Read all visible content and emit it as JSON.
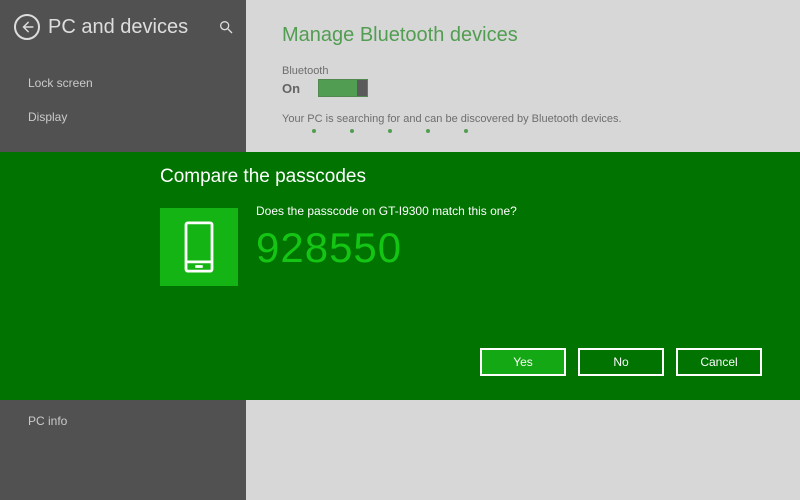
{
  "sidebar": {
    "title": "PC and devices",
    "items": [
      {
        "label": "Lock screen"
      },
      {
        "label": "Display"
      },
      {
        "label": "PC info"
      }
    ]
  },
  "main": {
    "title": "Manage Bluetooth devices",
    "bluetooth_label": "Bluetooth",
    "bluetooth_state": "On",
    "searching_text": "Your PC is searching for and can be discovered by Bluetooth devices."
  },
  "dialog": {
    "title": "Compare the passcodes",
    "prompt": "Does the passcode on GT-I9300 match this one?",
    "passcode": "928550",
    "yes": "Yes",
    "no": "No",
    "cancel": "Cancel"
  }
}
